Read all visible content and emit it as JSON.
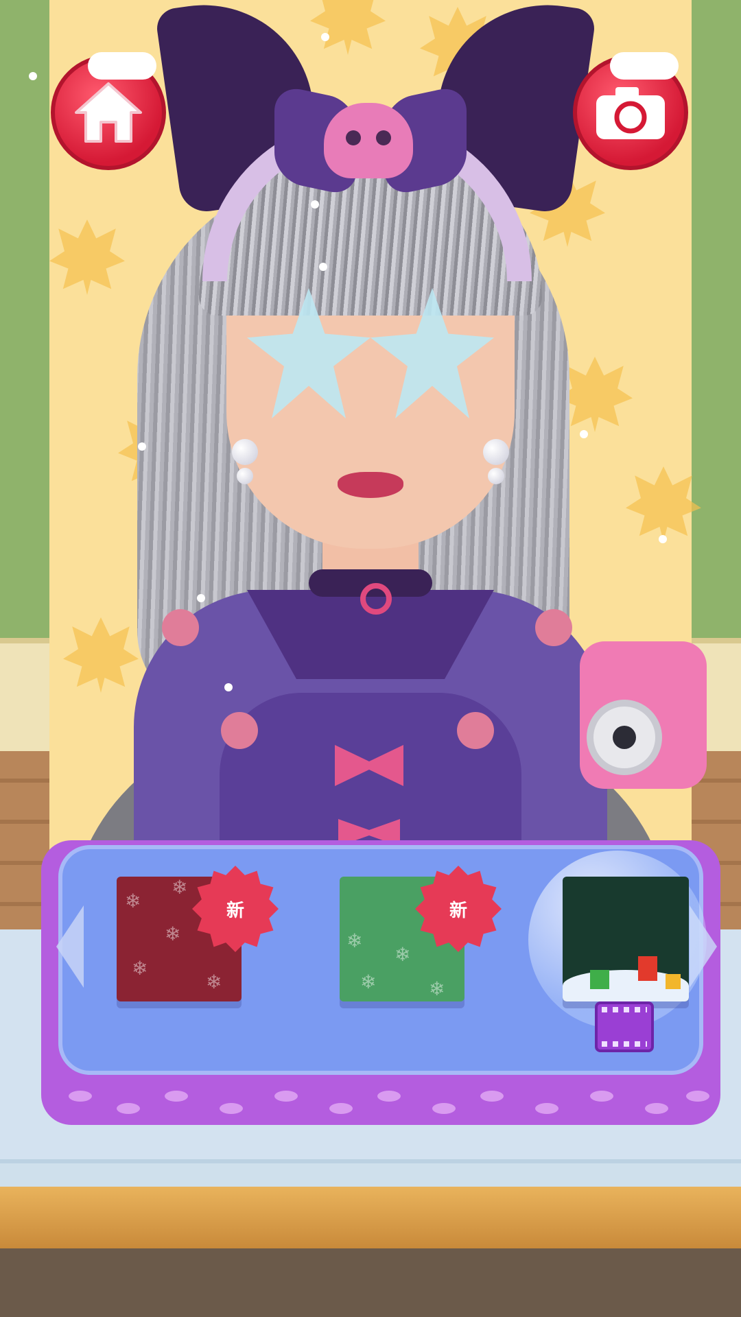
{
  "screen": {
    "type": "dress-up game",
    "theme": "winter / Christmas"
  },
  "top_bar": {
    "home_button_icon": "house-icon",
    "camera_button_icon": "camera-icon",
    "button_color": "#e0253f"
  },
  "character": {
    "hair": "long silver-gray",
    "accessory": "purple bunny-ear headband with skull bow",
    "glasses": "light blue star sunglasses",
    "outfit": "purple dress with pink bows and pompoms",
    "prop": "pink instant camera"
  },
  "tray": {
    "left_arrow_icon": "chevron-left-icon",
    "right_arrow_icon": "chevron-right-icon",
    "items": [
      {
        "name": "red snowflake background",
        "color": "#8b2333",
        "badge": "新"
      },
      {
        "name": "green snowflake background",
        "color": "#4aa063",
        "badge": "新"
      },
      {
        "name": "christmas lights scene",
        "color": "#183a2e",
        "badge": "",
        "locked_by": "film-icon"
      }
    ]
  },
  "colors": {
    "wallpaper": "#fbe09a",
    "wall": "#8fb36b",
    "tray": "#b45ddf",
    "tray_inner": "#7b9af2"
  }
}
